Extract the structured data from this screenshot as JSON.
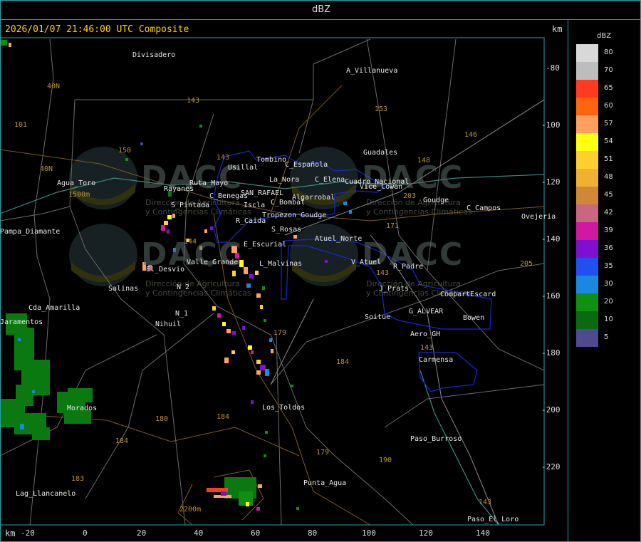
{
  "header": {
    "title": "dBZ"
  },
  "map": {
    "timestamp": "2026/01/07 21:46:00 UTC Composite",
    "km_label_top": "km",
    "km_label_bottom": "km",
    "y_ticks": [
      "-80",
      "-100",
      "-120",
      "-140",
      "-160",
      "-180",
      "-200",
      "-220"
    ],
    "x_ticks": [
      "-20",
      "0",
      "20",
      "40",
      "60",
      "80",
      "100",
      "120",
      "140"
    ],
    "watermark": {
      "brand": "DACC",
      "line1": "Dirección de Agricultura",
      "line2": "y Contingencias Climáticas"
    },
    "places": [
      "Divisadero",
      "A_Villanueva",
      "Guadales",
      "Tombino",
      "Usillal",
      "C_Española",
      "La_Nora",
      "C_Elena",
      "Cuadro_Nacional",
      "Goudge",
      "C_Campos",
      "Ovejeria",
      "Agua_Toro",
      "Pampa_Diamante",
      "Rayanes",
      "S_Pintada",
      "C_Benegas",
      "SAN_RAFAEL",
      "C_Bombal",
      "Algarrobal",
      "Iscla",
      "Tropezon_Goudge",
      "R_Caida",
      "S_Rosas",
      "Atuel_Norte",
      "E_Escurial",
      "Valle_Grande",
      "L_Malvinas",
      "V_Atuel",
      "R_Padre",
      "El_Desvio",
      "Salinas",
      "N_2",
      "N_1",
      "Nihuil",
      "J_Prats",
      "CompartEscard",
      "G_ALVEAR",
      "Bowen",
      "Soitue",
      "Aero_GH",
      "Carmensa",
      "Cda_Amarilla",
      "Jaramentos",
      "Los_Toldos",
      "Morados",
      "Paso_Burroso",
      "Punta_Agua",
      "Lag_Llancanelo",
      "Paso_El_Loro",
      "Vice_Cowan",
      "Ruta_Mayo"
    ],
    "roads": [
      "40N",
      "40N",
      "101",
      "143",
      "153",
      "150",
      "143",
      "146",
      "148",
      "203",
      "144",
      "171",
      "143",
      "205",
      "179",
      "184",
      "180",
      "184",
      "179",
      "190",
      "183",
      "184",
      "143",
      "143",
      "1500m",
      "2200m"
    ]
  },
  "legend": {
    "title": "dBZ",
    "items": [
      {
        "value": "80",
        "color": "#d8d8d8"
      },
      {
        "value": "70",
        "color": "#bdbdbd"
      },
      {
        "value": "65",
        "color": "#ff3a20"
      },
      {
        "value": "60",
        "color": "#ff6410"
      },
      {
        "value": "57",
        "color": "#ffa060"
      },
      {
        "value": "54",
        "color": "#ffff10"
      },
      {
        "value": "51",
        "color": "#ffd030"
      },
      {
        "value": "48",
        "color": "#f0b030"
      },
      {
        "value": "45",
        "color": "#d08838"
      },
      {
        "value": "42",
        "color": "#c86880"
      },
      {
        "value": "39",
        "color": "#d018a0"
      },
      {
        "value": "36",
        "color": "#8010d0"
      },
      {
        "value": "35",
        "color": "#2050f0"
      },
      {
        "value": "30",
        "color": "#1888e0"
      },
      {
        "value": "20",
        "color": "#109010"
      },
      {
        "value": "10",
        "color": "#0a6a10"
      },
      {
        "value": "5",
        "color": "#504890"
      }
    ]
  }
}
